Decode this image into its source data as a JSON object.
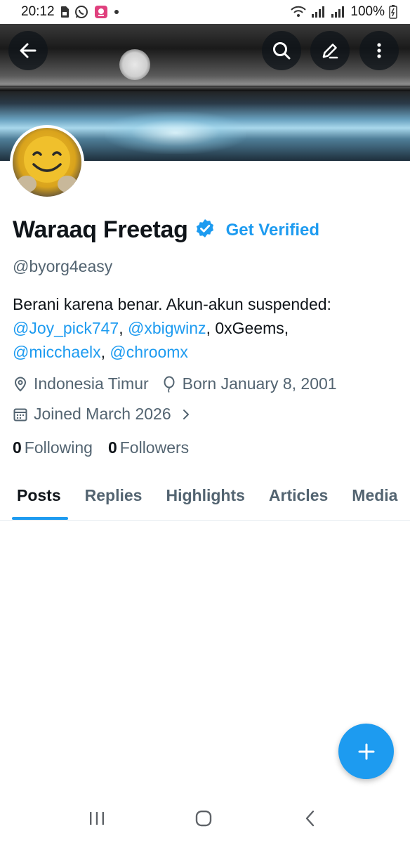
{
  "status_bar": {
    "time": "20:12",
    "battery": "100%"
  },
  "header": {
    "back_icon": "arrow-left-icon",
    "search_icon": "search-icon",
    "edit_icon": "pencil-icon",
    "more_icon": "more-vertical-icon"
  },
  "profile": {
    "display_name": "Waraaq Freetag",
    "verified_icon": "verified-badge-icon",
    "get_verified_label": "Get Verified",
    "handle": "@byorg4easy",
    "bio_text": "Berani karena benar. Akun-akun suspended:",
    "bio_mentions": [
      "@Joy_pick747",
      "@xbigwinz",
      "0xGeems",
      "@micchaelx",
      "@chroomx"
    ],
    "bio_separators": [
      ", ",
      ", ",
      ", ",
      ", "
    ],
    "location": "Indonesia Timur",
    "birthday": "Born January 8, 2001",
    "joined": "Joined March 2026",
    "following_count": "0",
    "following_label": "Following",
    "followers_count": "0",
    "followers_label": "Followers"
  },
  "tabs": [
    {
      "label": "Posts",
      "active": true
    },
    {
      "label": "Replies",
      "active": false
    },
    {
      "label": "Highlights",
      "active": false
    },
    {
      "label": "Articles",
      "active": false
    },
    {
      "label": "Media",
      "active": false
    }
  ],
  "colors": {
    "accent": "#1d9bf0",
    "text_primary": "#0f1419",
    "text_secondary": "#536471"
  }
}
